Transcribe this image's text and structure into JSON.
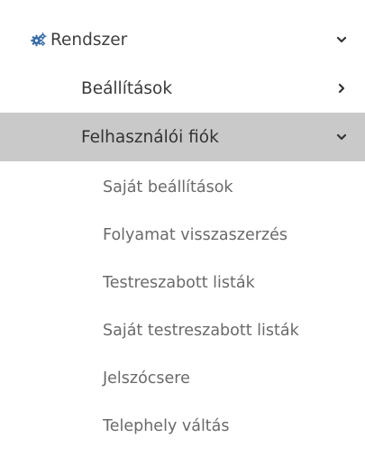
{
  "menu": {
    "accent_color": "#3b6ea8",
    "selected_bg": "#c9c9c9",
    "system": {
      "label": "Rendszer",
      "icon": "gears-icon",
      "expanded": true
    },
    "settings": {
      "label": "Beállítások",
      "expanded": false
    },
    "account": {
      "label": "Felhasználói fiók",
      "expanded": true,
      "items": [
        {
          "label": "Saját beállítások"
        },
        {
          "label": "Folyamat visszaszerzés"
        },
        {
          "label": "Testreszabott listák"
        },
        {
          "label": "Saját testreszabott listák"
        },
        {
          "label": "Jelszócsere"
        },
        {
          "label": "Telephely váltás"
        }
      ]
    }
  }
}
